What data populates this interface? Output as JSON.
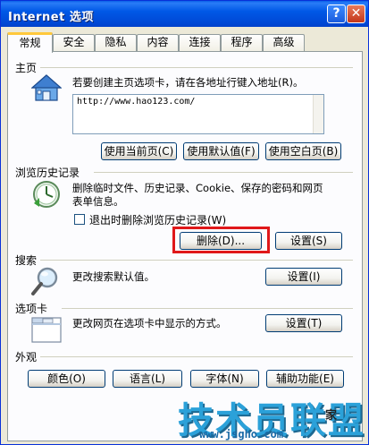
{
  "window": {
    "title": "Internet 选项",
    "help_label": "?",
    "close_label": "✕"
  },
  "tabs": [
    {
      "label": "常规",
      "active": true
    },
    {
      "label": "安全",
      "active": false
    },
    {
      "label": "隐私",
      "active": false
    },
    {
      "label": "内容",
      "active": false
    },
    {
      "label": "连接",
      "active": false
    },
    {
      "label": "程序",
      "active": false
    },
    {
      "label": "高级",
      "active": false
    }
  ],
  "homepage": {
    "group_label": "主页",
    "description": "若要创建主页选项卡，请在各地址行键入地址(R)。",
    "url": "http://www.hao123.com/",
    "use_current": "使用当前页(C)",
    "use_default": "使用默认值(F)",
    "use_blank": "使用空白页(B)"
  },
  "history": {
    "group_label": "浏览历史记录",
    "description_line1": "删除临时文件、历史记录、Cookie、保存的密码和网页",
    "description_line2": "表单信息。",
    "checkbox_label": "退出时删除浏览历史记录(W)",
    "checkbox_checked": false,
    "delete_button": "删除(D)...",
    "settings_button": "设置(S)"
  },
  "search": {
    "group_label": "搜索",
    "description": "更改搜索默认值。",
    "settings_button": "设置(I)"
  },
  "tabsection": {
    "group_label": "选项卡",
    "description": "更改网页在选项卡中显示的方式。",
    "settings_button": "设置(T)"
  },
  "appearance": {
    "group_label": "外观",
    "colors_button": "颜色(O)",
    "languages_button": "语言(L)",
    "fonts_button": "字体(N)",
    "accessibility_button": "辅助功能(E)"
  },
  "watermark": {
    "text": "技术员联盟",
    "sub": "家",
    "url": "www.jsgho.com"
  },
  "colors": {
    "highlight": "#e0181a",
    "titlebar": "#0058e6",
    "active_tab_accent": "#ffc83c"
  }
}
